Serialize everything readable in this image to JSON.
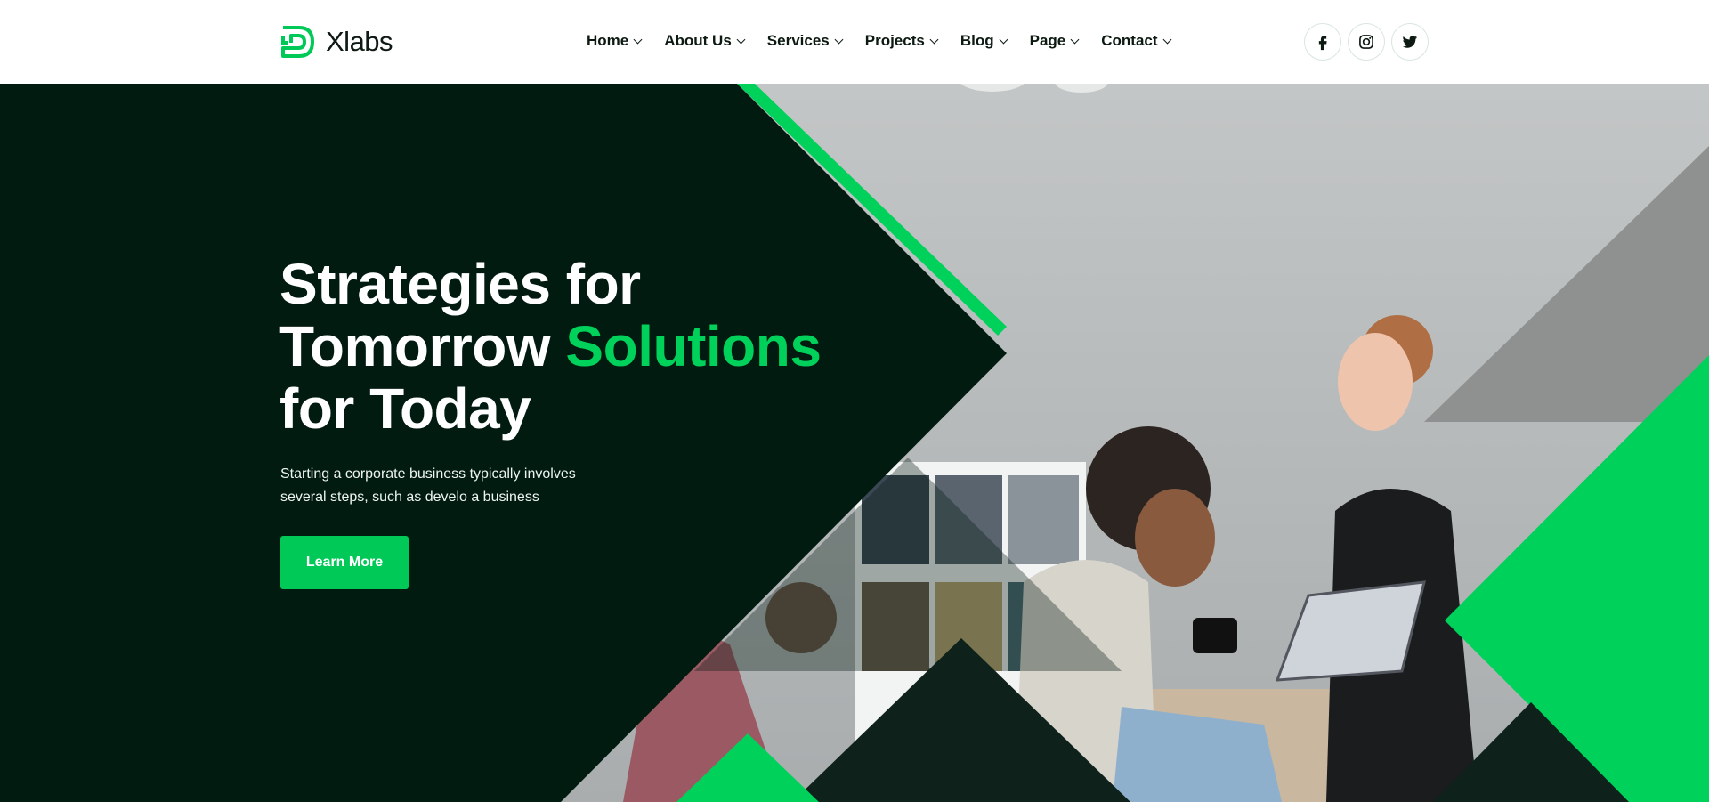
{
  "brand": {
    "name": "Xlabs",
    "icon": "xlabs-logo-icon",
    "accent_color": "#00d15b",
    "dark_color": "#021b10"
  },
  "nav": {
    "items": [
      {
        "label": "Home",
        "icon": "chevron-down-icon"
      },
      {
        "label": "About Us",
        "icon": "chevron-down-icon"
      },
      {
        "label": "Services",
        "icon": "chevron-down-icon"
      },
      {
        "label": "Projects",
        "icon": "chevron-down-icon"
      },
      {
        "label": "Blog",
        "icon": "chevron-down-icon"
      },
      {
        "label": "Page",
        "icon": "chevron-down-icon"
      },
      {
        "label": "Contact",
        "icon": "chevron-down-icon"
      }
    ]
  },
  "social": [
    {
      "name": "facebook",
      "icon": "facebook-icon"
    },
    {
      "name": "instagram",
      "icon": "instagram-icon"
    },
    {
      "name": "twitter",
      "icon": "twitter-icon"
    }
  ],
  "hero": {
    "headline_part1": "Strategies for Tomorrow",
    "headline_accent": "Solutions",
    "headline_part2": "for Today",
    "description": "Starting a corporate business typically involves several steps, such as develo a business",
    "cta_label": "Learn More",
    "image": "office-team-photo"
  }
}
